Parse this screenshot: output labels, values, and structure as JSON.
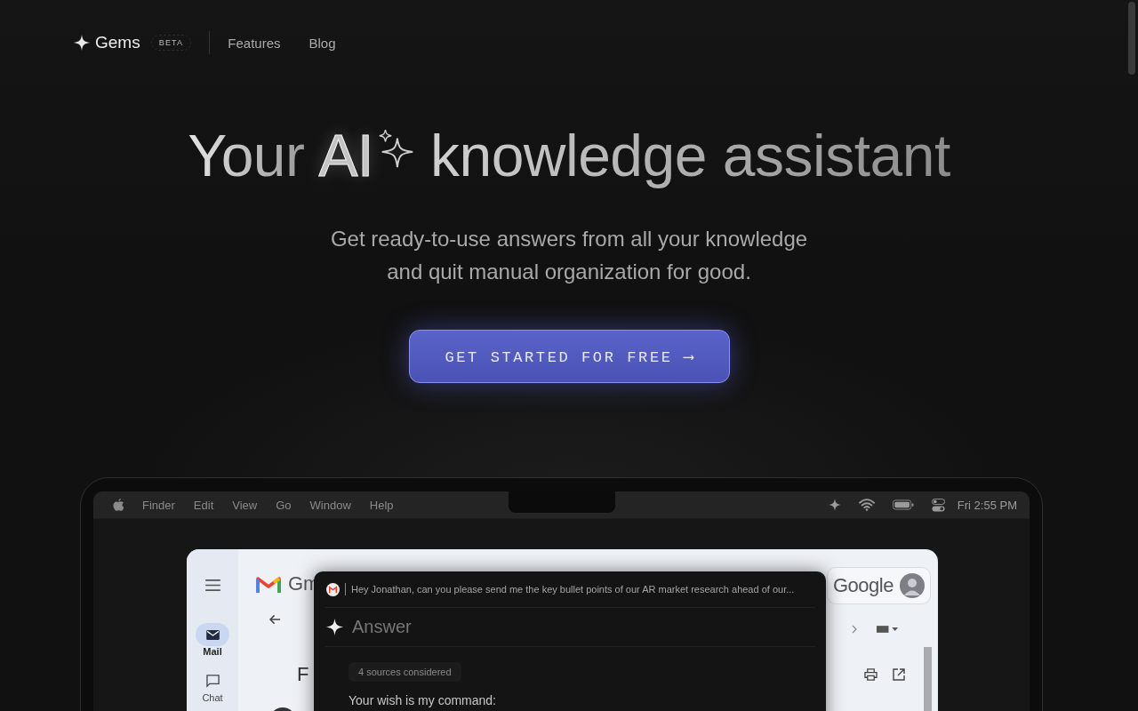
{
  "nav": {
    "brand": "Gems",
    "badge": "BETA",
    "links": [
      "Features",
      "Blog"
    ]
  },
  "hero": {
    "title_before": "Your",
    "title_highlight": "AI",
    "title_after": "knowledge assistant",
    "subtitle_lines": [
      "Get ready-to-use answers from all your knowledge",
      "and quit manual organization for good."
    ],
    "cta": "GET STARTED FOR FREE",
    "cta_arrow": "⟶"
  },
  "laptop": {
    "menu_bar": {
      "items": [
        "Finder",
        "Edit",
        "View",
        "Go",
        "Window",
        "Help"
      ],
      "clock": "Fri 2:55 PM"
    },
    "gmail": {
      "brand": "Gm",
      "logo_text": "Google",
      "subject": "F",
      "nav": [
        {
          "label": "Mail",
          "selected": true
        },
        {
          "label": "Chat",
          "selected": false
        }
      ]
    },
    "assistant": {
      "query": "Hey Jonathan, can you please send me the key bullet points of our AR market research ahead of our...",
      "heading": "Answer",
      "sources": "4 sources considered",
      "reply": "Your wish is my command:"
    }
  }
}
